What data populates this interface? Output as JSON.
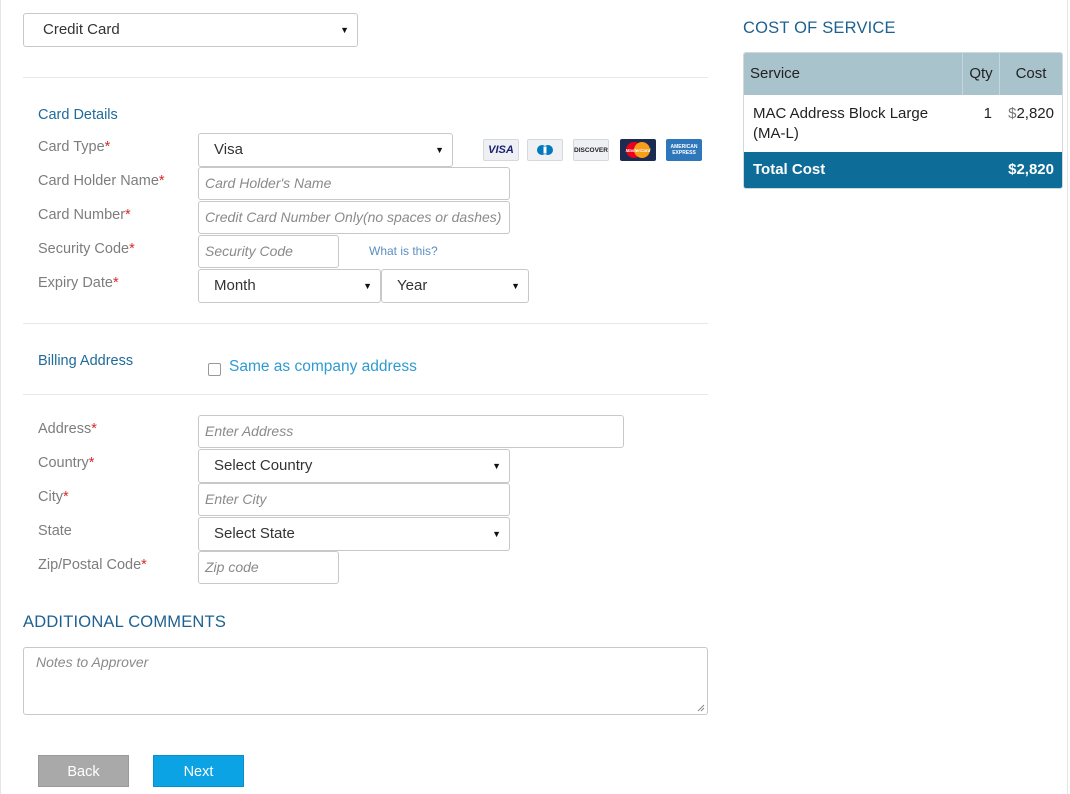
{
  "payment_method": {
    "selected": "Credit Card"
  },
  "card_details": {
    "title": "Card Details",
    "card_type": {
      "label": "Card Type",
      "selected": "Visa"
    },
    "holder_name": {
      "label": "Card Holder Name",
      "placeholder": "Card Holder's Name"
    },
    "card_number": {
      "label": "Card Number",
      "placeholder": "Credit Card Number Only(no spaces or dashes)"
    },
    "security_code": {
      "label": "Security Code",
      "placeholder": "Security Code",
      "help_link": "What is this?"
    },
    "expiry": {
      "label": "Expiry Date",
      "month": "Month",
      "year": "Year"
    },
    "required_mark": "*",
    "card_logos": [
      {
        "name": "visa",
        "text": "VISA",
        "color": "#1a1f71"
      },
      {
        "name": "diners",
        "text": "",
        "color": "#0079be"
      },
      {
        "name": "discover",
        "text": "DISCOVER",
        "color": "#f58220"
      },
      {
        "name": "mastercard",
        "text": "MasterCard",
        "color": "#eb001b"
      },
      {
        "name": "amex",
        "text": "AMERICAN EXPRESS",
        "color": "#2e77bb"
      }
    ]
  },
  "billing": {
    "title": "Billing Address",
    "same_as_company": "Same as company address",
    "address": {
      "label": "Address",
      "placeholder": "Enter Address"
    },
    "country": {
      "label": "Country",
      "selected": "Select Country"
    },
    "city": {
      "label": "City",
      "placeholder": "Enter City"
    },
    "state": {
      "label": "State",
      "selected": "Select State"
    },
    "zip": {
      "label": "Zip/Postal Code",
      "placeholder": "Zip code"
    }
  },
  "comments": {
    "heading": "ADDITIONAL COMMENTS",
    "placeholder": "Notes to Approver"
  },
  "buttons": {
    "back": "Back",
    "next": "Next"
  },
  "cost_of_service": {
    "heading": "COST OF SERVICE",
    "columns": {
      "service": "Service",
      "qty": "Qty",
      "cost": "Cost"
    },
    "rows": [
      {
        "service": "MAC Address Block Large (MA-L)",
        "qty": "1",
        "currency": "$",
        "amount": "2,820"
      }
    ],
    "total_label": "Total Cost",
    "total_value": "$2,820"
  },
  "colors": {
    "accent": "#0d6c98",
    "link": "#2e9bd1",
    "next_button": "#0ba3e3",
    "back_button": "#a9a9a9",
    "table_header": "#a9c3cc",
    "required": "#d42a2a"
  }
}
